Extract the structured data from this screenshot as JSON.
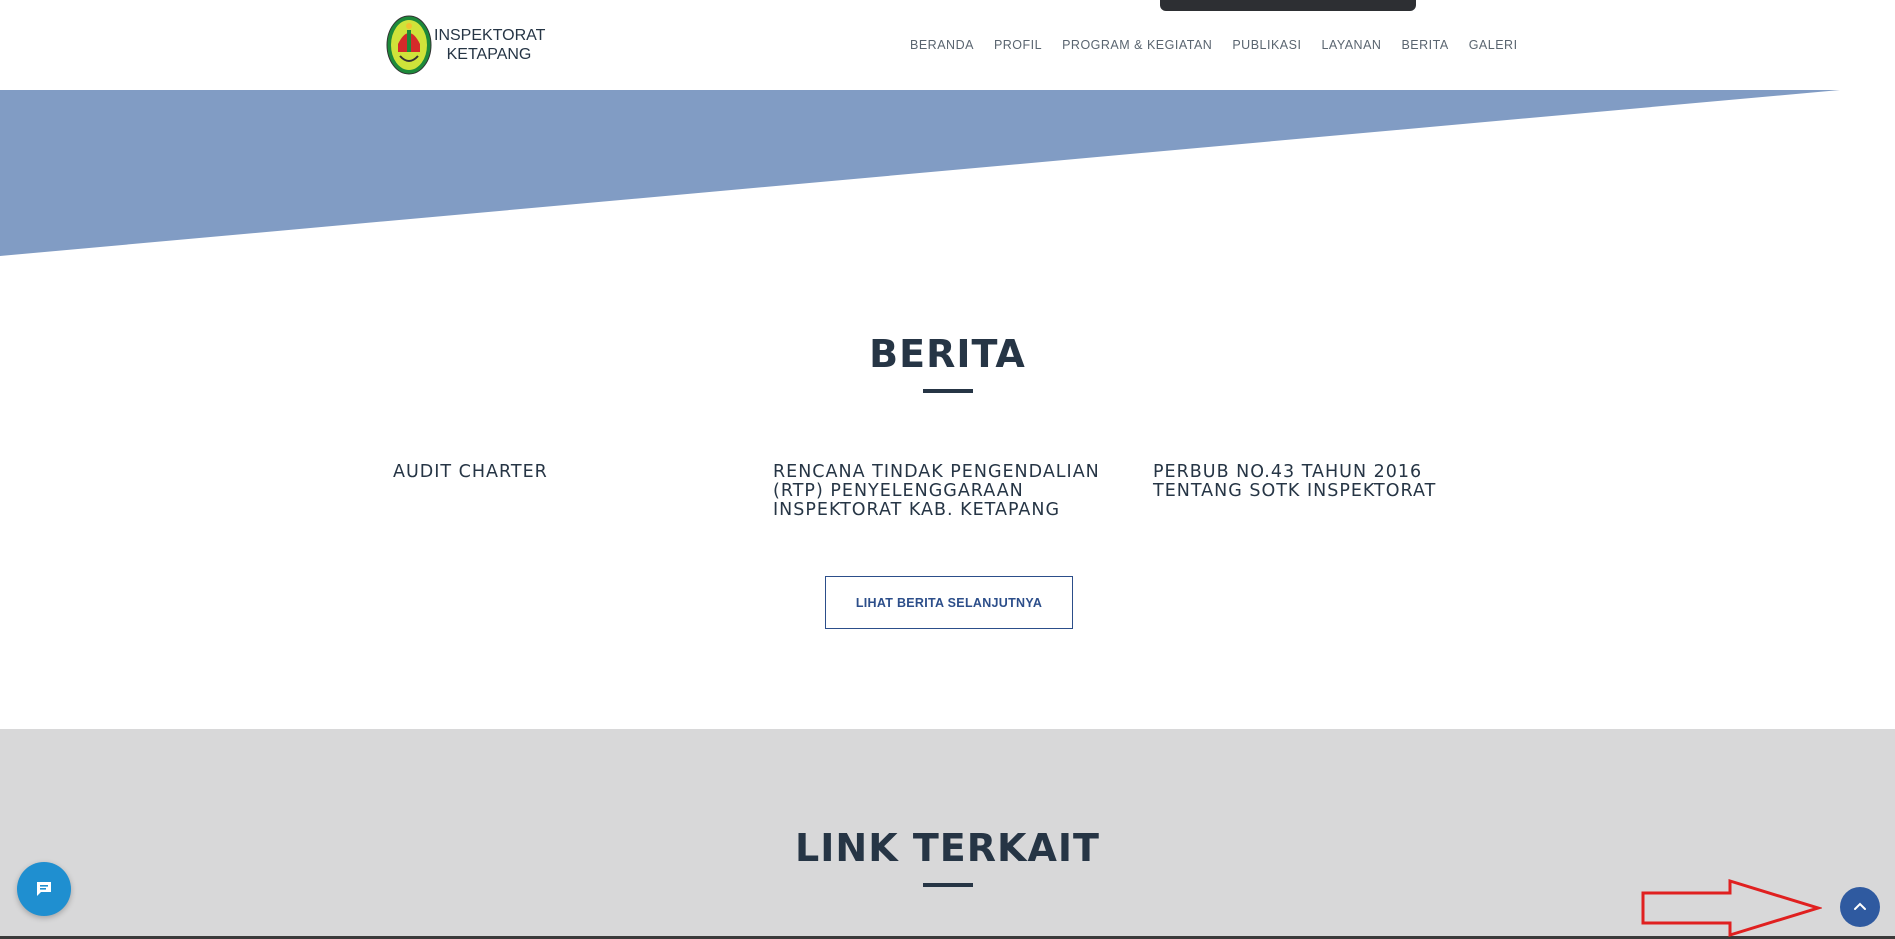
{
  "header": {
    "brand_line1": "INSPEKTORAT",
    "brand_line2": "KETAPANG",
    "nav": [
      {
        "label": "BERANDA"
      },
      {
        "label": "PROFIL"
      },
      {
        "label": "PROGRAM & KEGIATAN"
      },
      {
        "label": "PUBLIKASI"
      },
      {
        "label": "LAYANAN"
      },
      {
        "label": "BERITA"
      },
      {
        "label": "GALERI"
      }
    ]
  },
  "berita": {
    "title": "BERITA",
    "items": [
      {
        "title": "AUDIT CHARTER"
      },
      {
        "title": "RENCANA TINDAK PENGENDALIAN (RTP) PENYELENGGARAAN INSPEKTORAT KAB. KETAPANG"
      },
      {
        "title": "PERBUB NO.43 TAHUN 2016 TENTANG SOTK INSPEKTORAT"
      }
    ],
    "more_button": "LIHAT BERITA SELANJUTNYA"
  },
  "link_terkait": {
    "title": "LINK TERKAIT"
  },
  "colors": {
    "heading": "#263545",
    "wedge": "#819cc4",
    "accent": "#2c4e8a",
    "chat": "#1f8fd0",
    "scroll_top": "#2f5aa0",
    "annotation": "#e02020"
  },
  "icons": {
    "chat": "chat-bubble-icon",
    "scroll_top": "chevron-up-icon",
    "logo": "government-emblem-icon",
    "annotation": "red-arrow-icon"
  }
}
